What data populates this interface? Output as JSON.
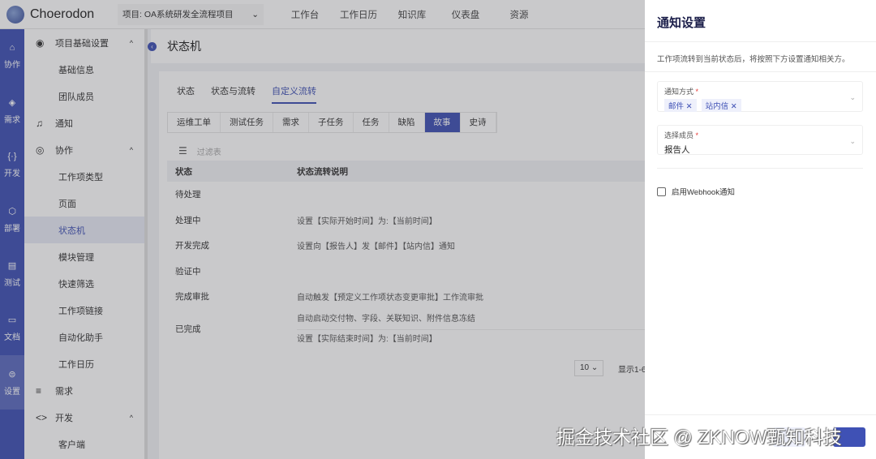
{
  "header": {
    "brand": "Choerodon",
    "project": "项目: OA系统研发全流程项目",
    "nav": [
      "工作台",
      "工作日历",
      "知识库",
      "仪表盘",
      "资源"
    ]
  },
  "rail": [
    {
      "icon": "collab-icon",
      "label": "协作"
    },
    {
      "icon": "layers-icon",
      "label": "需求"
    },
    {
      "icon": "code-icon",
      "label": "开发"
    },
    {
      "icon": "deploy-icon",
      "label": "部署"
    },
    {
      "icon": "clipboard-icon",
      "label": "测试"
    },
    {
      "icon": "inbox-icon",
      "label": "文档"
    },
    {
      "icon": "settings-icon",
      "label": "设置"
    }
  ],
  "sidebar": {
    "g1": "项目基础设置",
    "g1items": [
      "基础信息",
      "团队成员"
    ],
    "notice": "通知",
    "g2": "协作",
    "g2items": [
      "工作项类型",
      "页面",
      "状态机",
      "模块管理",
      "快速筛选",
      "工作项链接",
      "自动化助手",
      "工作日历"
    ],
    "req": "需求",
    "dev": "开发",
    "devitems": [
      "客户端"
    ]
  },
  "page": {
    "title": "状态机",
    "tabs": [
      "状态",
      "状态与流转",
      "自定义流转"
    ],
    "types": [
      "运维工单",
      "测试任务",
      "需求",
      "子任务",
      "任务",
      "缺陷",
      "故事",
      "史诗"
    ],
    "filter_placeholder": "过滤表",
    "columns": [
      "状态",
      "状态流转说明"
    ],
    "rows": [
      {
        "s": "待处理",
        "d": []
      },
      {
        "s": "处理中",
        "d": [
          "设置【实际开始时间】为:【当前时间】"
        ]
      },
      {
        "s": "开发完成",
        "d": [
          "设置向【报告人】发【邮件】【站内信】通知"
        ]
      },
      {
        "s": "验证中",
        "d": []
      },
      {
        "s": "完成审批",
        "d": [
          "自动触发【预定义工作项状态变更审批】工作流审批"
        ]
      },
      {
        "s": "已完成",
        "d": [
          "自动启动交付物、字段、关联知识、附件信息冻结",
          "设置【实际结束时间】为:【当前时间】"
        ]
      }
    ],
    "page_size": "10",
    "range": "显示1-6"
  },
  "drawer": {
    "title": "通知设置",
    "desc": "工作项流转到当前状态后，将按照下方设置通知相关方。",
    "method_label": "通知方式",
    "methods": [
      "邮件",
      "站内信"
    ],
    "member_label": "选择成员",
    "member": "报告人",
    "webhook": "启用Webhook通知"
  },
  "watermark": "掘金技术社区 @ ZKNOW甄知科技"
}
